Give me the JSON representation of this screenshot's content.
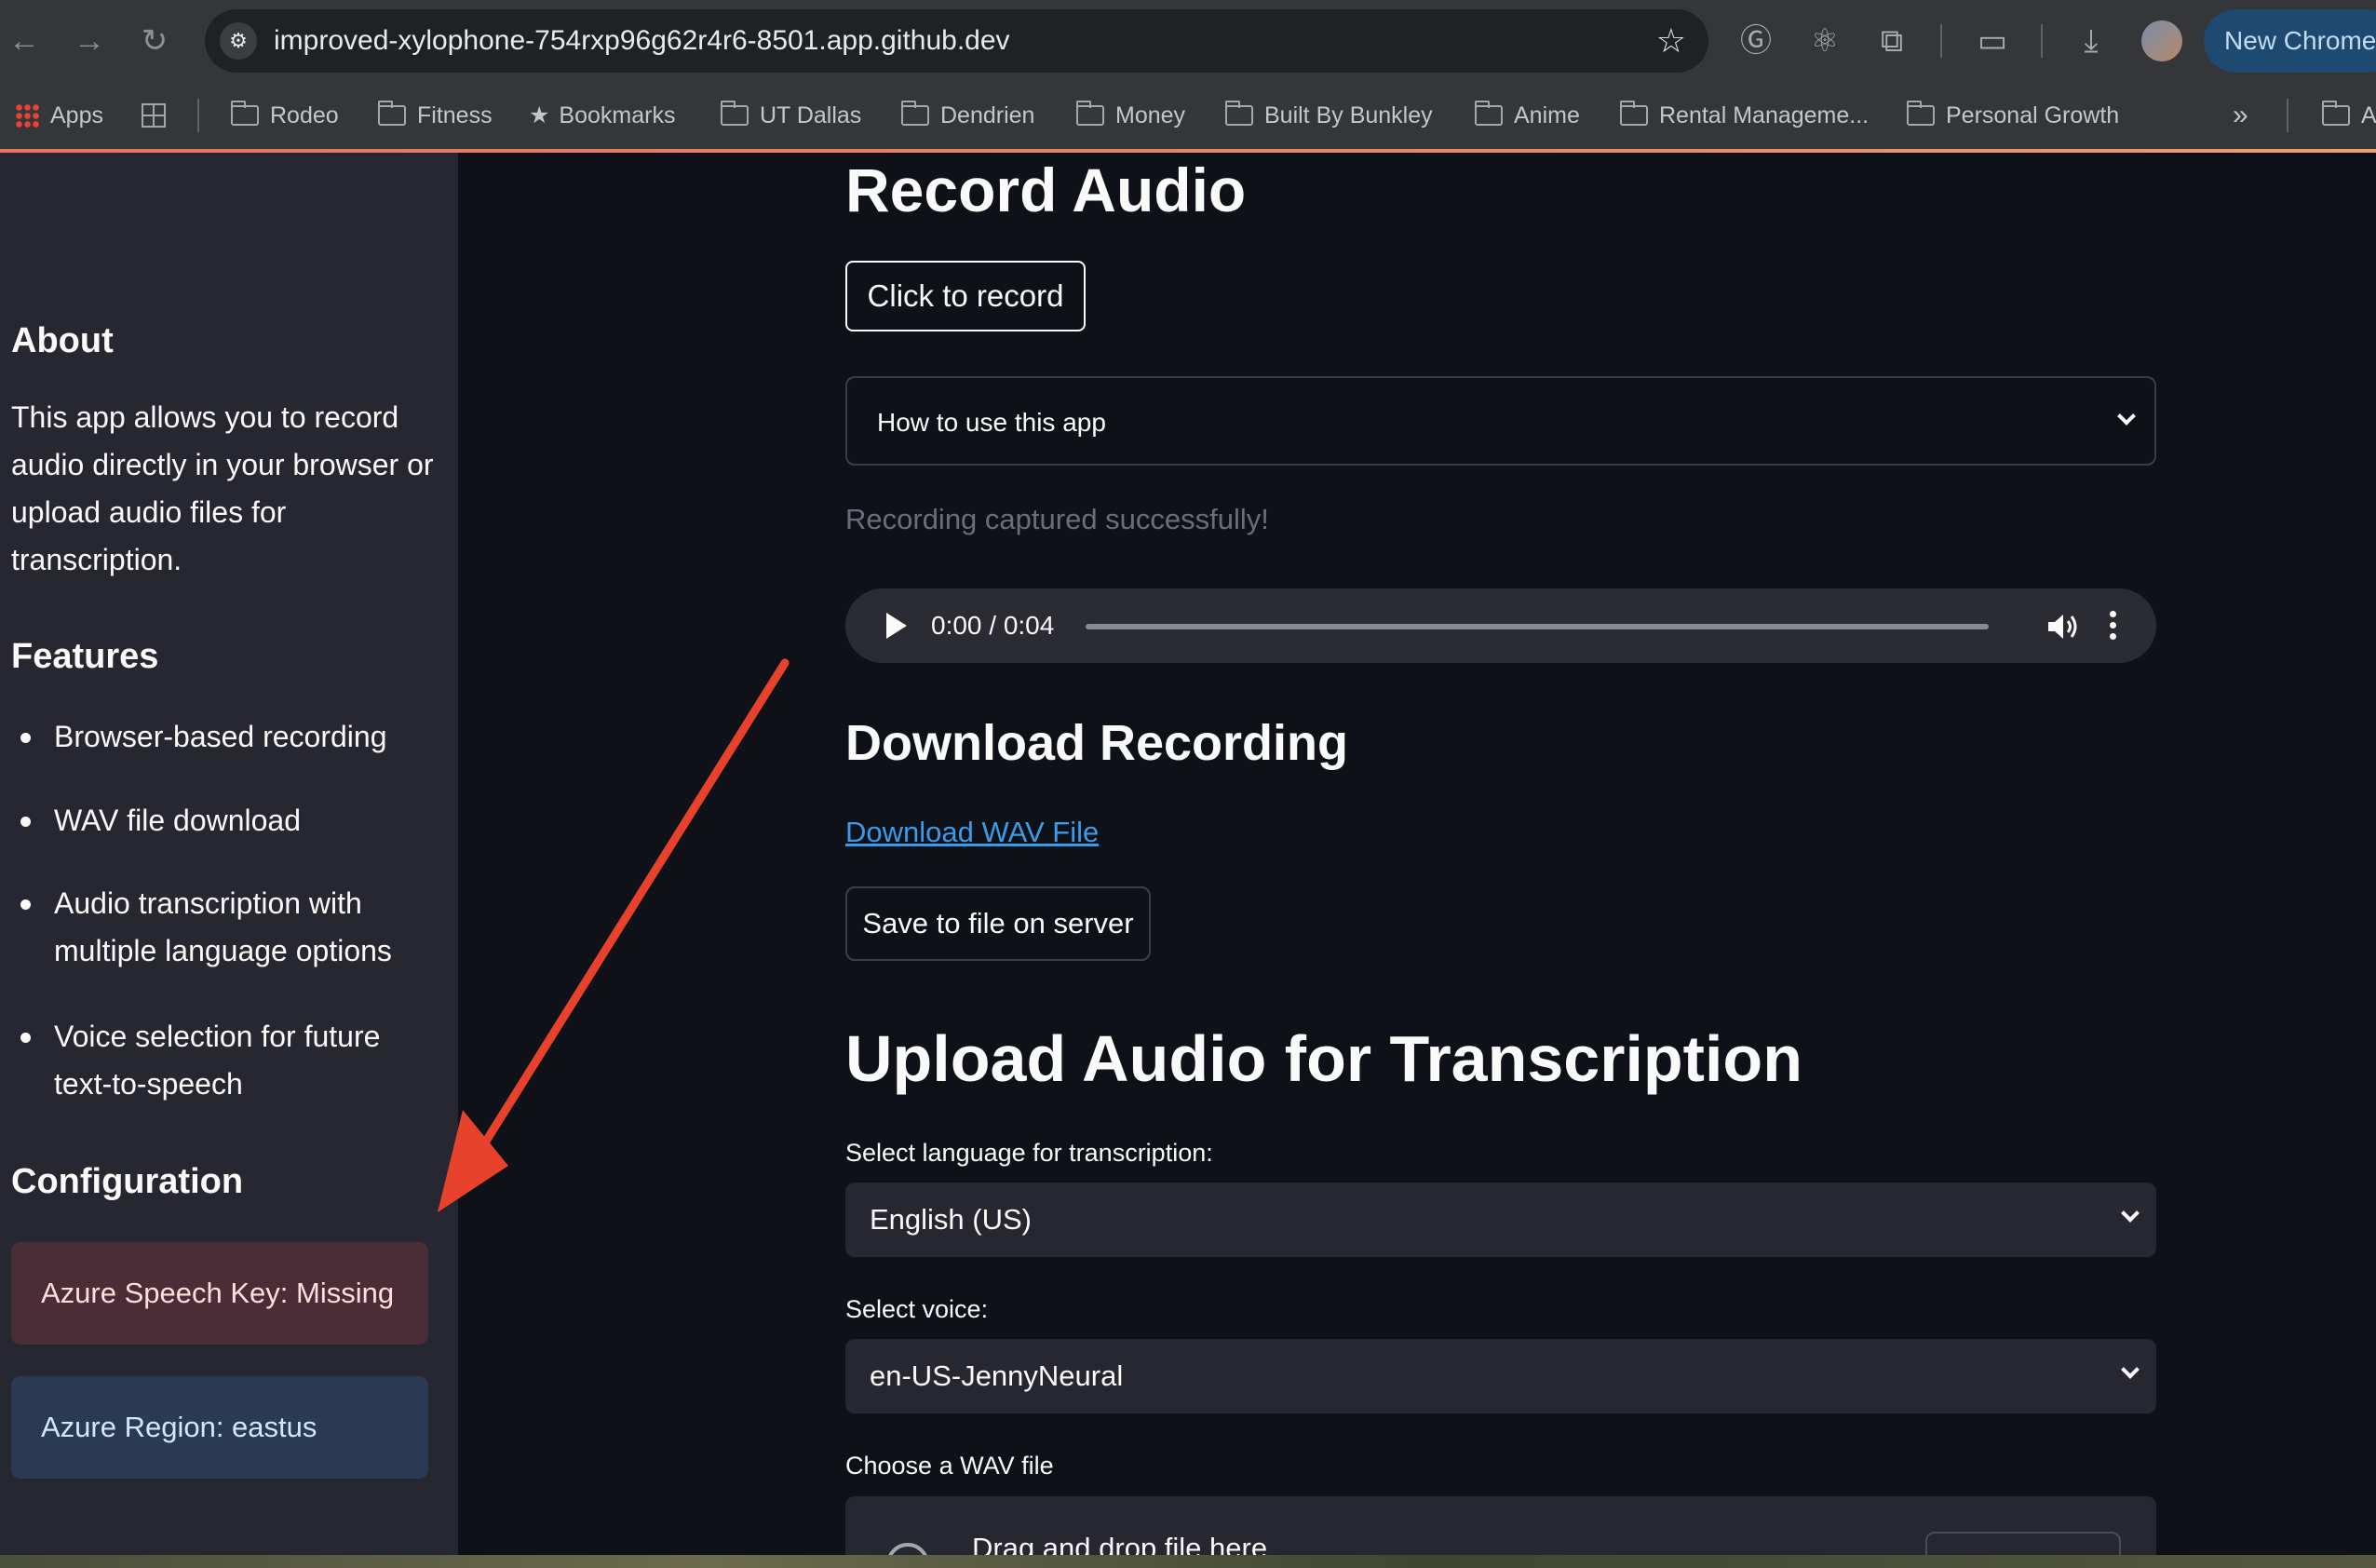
{
  "browser": {
    "url": "improved-xylophone-754rxp96g62r4r6-8501.app.github.dev",
    "profile_button": "New Chrome",
    "bookmarks": [
      "Apps",
      "Rodeo",
      "Fitness",
      "Bookmarks",
      "UT Dallas",
      "Dendrien",
      "Money",
      "Built By Bunkley",
      "Anime",
      "Rental Manageme...",
      "Personal Growth"
    ],
    "overflow_chevron": "»",
    "trailing_bookmark": "A"
  },
  "sidebar": {
    "about_heading": "About",
    "about_text": "This app allows you to record audio directly in your browser or upload audio files for transcription.",
    "features_heading": "Features",
    "features": [
      "Browser-based recording",
      "WAV file download",
      "Audio transcription with multiple language options",
      "Voice selection for future text-to-speech"
    ],
    "config_heading": "Configuration",
    "azure_key_status": "Azure Speech Key: Missing",
    "azure_region_status": "Azure Region: eastus"
  },
  "main": {
    "record_heading": "Record Audio",
    "record_button": "Click to record",
    "howto_expander": "How to use this app",
    "recording_status": "Recording captured successfully!",
    "audio_time": "0:00 / 0:04",
    "audio_progress": 0,
    "download_heading": "Download Recording",
    "download_link": "Download WAV File",
    "save_button": "Save to file on server",
    "upload_heading": "Upload Audio for Transcription",
    "language_label": "Select language for transcription:",
    "language_value": "English (US)",
    "voice_label": "Select voice:",
    "voice_value": "en-US-JennyNeural",
    "file_label": "Choose a WAV file",
    "dropzone_text": "Drag and drop file here"
  },
  "colors": {
    "app_background": "#0e1117",
    "sidebar_background": "#262730",
    "error_alert": "#4a2d36",
    "info_alert": "#2a3a52",
    "link": "#3b9be8",
    "annotation_arrow": "#e8412c"
  }
}
